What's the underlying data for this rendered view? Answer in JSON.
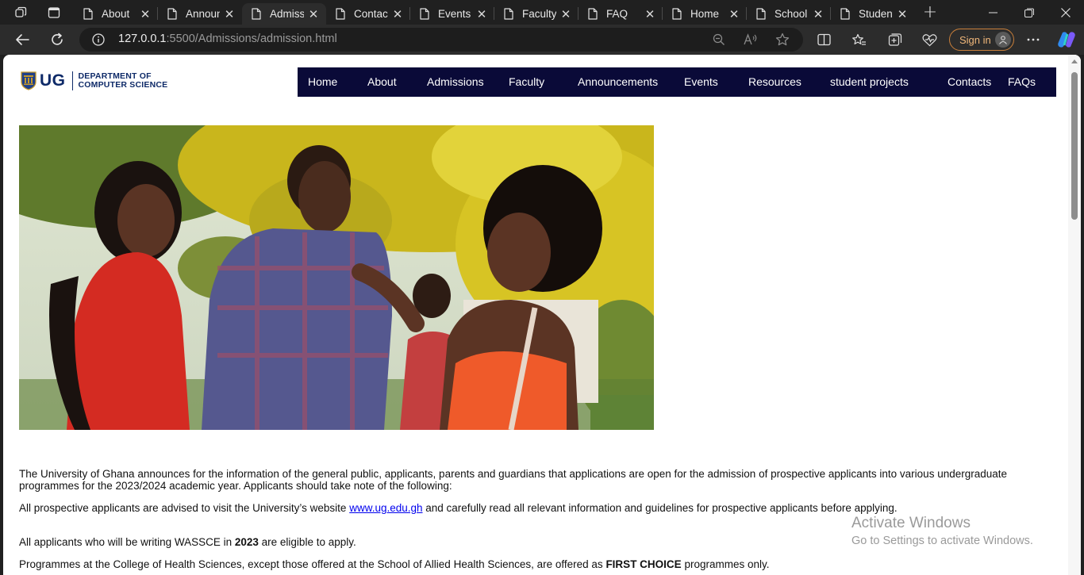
{
  "browser": {
    "tabs": [
      {
        "label": "About",
        "active": false
      },
      {
        "label": "Announ",
        "active": false
      },
      {
        "label": "Admissi",
        "active": true
      },
      {
        "label": "Contact",
        "active": false
      },
      {
        "label": "Events",
        "active": false
      },
      {
        "label": "Faculty",
        "active": false
      },
      {
        "label": "FAQ",
        "active": false
      },
      {
        "label": "Home",
        "active": false
      },
      {
        "label": "School",
        "active": false
      },
      {
        "label": "Student",
        "active": false
      }
    ],
    "url_host": "127.0.0.1",
    "url_path": ":5500/Admissions/admission.html",
    "signin_label": "Sign in",
    "accent_color": "#c97f3a"
  },
  "site": {
    "logo_abbr": "UG",
    "logo_line1": "DEPARTMENT OF",
    "logo_line2": "COMPUTER SCIENCE",
    "brand_color": "#0e2a68",
    "nav_color": "#0a0a38",
    "nav": [
      "Home",
      "About",
      "Admissions",
      "Faculty",
      "Announcements",
      "Events",
      "Resources",
      "student projects",
      "Contacts",
      "FAQs"
    ]
  },
  "content": {
    "para1": "The University of Ghana announces for the information of the general public, applicants, parents and guardians that applications are open for the admission of prospective applicants into various undergraduate programmes for the 2023/2024 academic year. Applicants should take note of the following:",
    "para2_before": "All prospective applicants are advised to visit the University’s website ",
    "para2_link": "www.ug.edu.gh",
    "para2_after": " and  carefully read all relevant information and guidelines for prospective applicants before applying.",
    "para3_before": "All applicants who will be writing WASSCE in ",
    "para3_bold": "2023",
    "para3_after": " are eligible to apply.",
    "para4_before": "Programmes at the College of  Health Sciences, except those offered at the School of Allied Health Sciences, are offered as ",
    "para4_bold": "FIRST CHOICE",
    "para4_after": "  programmes only."
  },
  "watermark": {
    "line1": "Activate Windows",
    "line2": "Go to Settings to activate Windows."
  }
}
